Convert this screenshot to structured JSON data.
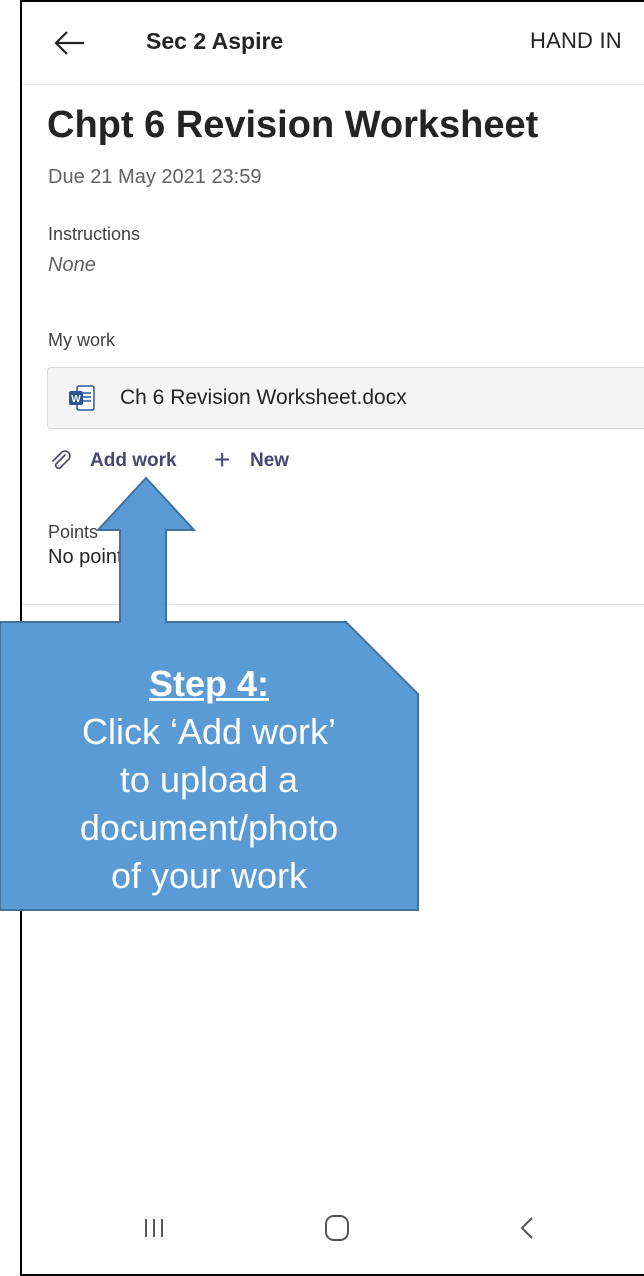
{
  "header": {
    "back_icon": "arrow-left-icon",
    "course_name": "Sec 2 Aspire",
    "hand_in_label": "HAND IN"
  },
  "assignment": {
    "title": "Chpt 6 Revision Worksheet",
    "due": "Due 21 May 2021 23:59",
    "instructions_label": "Instructions",
    "instructions_value": "None",
    "my_work_label": "My work",
    "file": {
      "name": "Ch 6 Revision Worksheet.docx",
      "icon": "word-doc-icon",
      "icon_letter": "W"
    },
    "add_work_label": "Add work",
    "new_label": "New",
    "points_label": "Points",
    "points_value": "No points"
  },
  "callout": {
    "step": "Step 4:",
    "lines": [
      "Click ‘Add work’",
      "to upload a",
      "document/photo",
      "of your work"
    ],
    "fill_color": "#5B9BD5",
    "border_color": "#41719C"
  },
  "navbar": {
    "recent_icon": "recent-apps-icon",
    "home_icon": "home-icon",
    "back_icon": "chevron-left-icon"
  }
}
